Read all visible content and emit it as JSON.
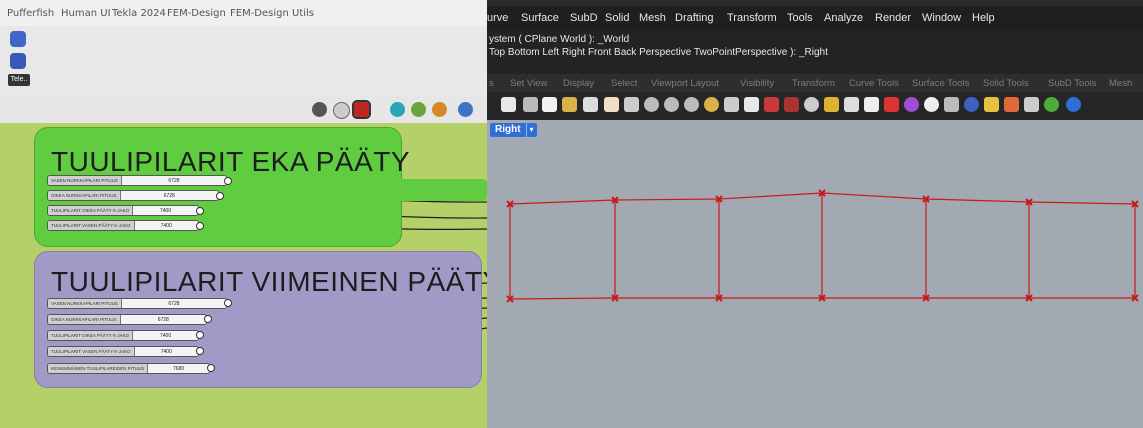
{
  "grasshopper": {
    "tabs": [
      "Pufferfish",
      "Human UI",
      "Tekla 2024",
      "FEM-Design",
      "FEM-Design Utils"
    ],
    "ribbon_label": "Tele..",
    "groups": [
      {
        "title": "TUULIPILARIT EKA PÄÄTY",
        "color": "#5fcd3f",
        "sliders": [
          {
            "label": "VASEN NURKKAPILARI PITUUS",
            "value": "6728"
          },
          {
            "label": "OIKEA NURKKAPILARI PITUUS",
            "value": "6728"
          },
          {
            "label": "TUULIPILARIT OIKEA PÄÄTY K-JAKO",
            "value": "7400"
          },
          {
            "label": "TUULIPILARIT VASEN PÄÄTY K-JAKO",
            "value": "7400"
          }
        ]
      },
      {
        "title": "TUULIPILARIT VIIMEINEN PÄÄTY",
        "color": "#a19ac6",
        "sliders": [
          {
            "label": "VASEN NURKKAPILARI PITUUS",
            "value": "6728"
          },
          {
            "label": "OIKEA NURKKAPILARI PITUUS",
            "value": "6728"
          },
          {
            "label": "TUULIPILARIT OIKEA PÄÄTY K-JAKO",
            "value": "7400"
          },
          {
            "label": "TUULIPILARIT VASEN PÄÄTY K-JAKO",
            "value": "7400"
          },
          {
            "label": "KESKIMMÄINEN TUULIPILAREIDEN PITUUS",
            "value": "7680"
          }
        ]
      }
    ]
  },
  "rhino": {
    "menu": [
      "urve",
      "Surface",
      "SubD",
      "Solid",
      "Mesh",
      "Drafting",
      "Transform",
      "Tools",
      "Analyze",
      "Render",
      "Window",
      "Help"
    ],
    "command_lines": [
      "ystem ( CPlane  World ): _World",
      "Top  Bottom  Left  Right  Front  Back  Perspective  TwoPointPerspective ): _Right"
    ],
    "toolbar_tabs": [
      "s",
      "Set View",
      "Display",
      "Select",
      "Viewport Layout",
      "Visibility",
      "Transform",
      "Curve Tools",
      "Surface Tools",
      "Solid Tools",
      "SubD Tools",
      "Mesh"
    ],
    "viewport": {
      "name": "Right",
      "dropdown": "▾"
    }
  },
  "colors": {
    "canvas": "#b5d069",
    "viewport": "#a2a9b2",
    "frame": "#c81a1a",
    "accent": "#2f6fd6"
  }
}
